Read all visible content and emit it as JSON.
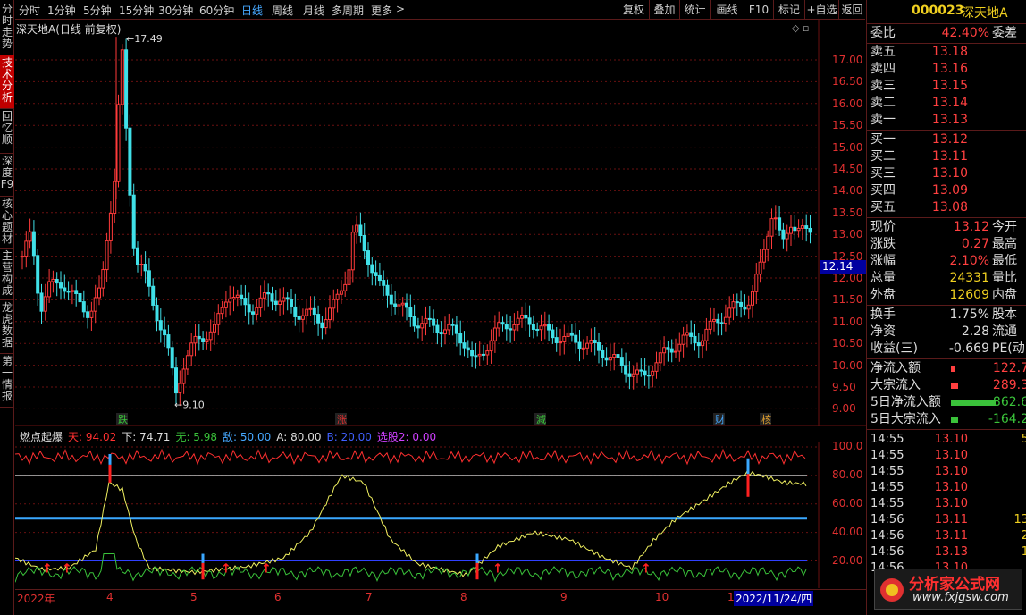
{
  "sidebar": {
    "tabs": [
      "分时走势",
      "技术分析",
      "回忆顺",
      "深度F9",
      "核心题材",
      "主营构成",
      "龙虎数据",
      "第一情报"
    ],
    "active": 1
  },
  "topbar": {
    "timeframes": [
      "分时",
      "1分钟",
      "5分钟",
      "15分钟",
      "30分钟",
      "60分钟",
      "日线",
      "周线",
      "月线",
      "多周期",
      "更多"
    ],
    "active_timeframe": "日线",
    "tools": [
      "复权",
      "叠加",
      "统计",
      "画线",
      "F10",
      "标记",
      "+自选",
      "返回"
    ]
  },
  "chart": {
    "title": "深天地A(日线 前复权)",
    "high_label": "17.49",
    "low_label": "9.10",
    "price_axis": [
      "17.00",
      "16.50",
      "16.00",
      "15.50",
      "15.00",
      "14.50",
      "14.00",
      "13.50",
      "13.00",
      "12.50",
      "12.00",
      "11.50",
      "11.00",
      "10.50",
      "10.00",
      "9.50",
      "9.00"
    ],
    "current_price": "12.14",
    "signals": [
      {
        "text": "跌",
        "color": "#3ac23a"
      },
      {
        "text": "涨",
        "color": "#e03030"
      },
      {
        "text": "減",
        "color": "#3ac23a"
      },
      {
        "text": "财",
        "color": "#46a8ff"
      },
      {
        "text": "核",
        "color": "#e0a030"
      }
    ]
  },
  "indicator": {
    "name": "燃点起爆",
    "params": [
      {
        "label": "天: 94.02",
        "color": "#ff3030"
      },
      {
        "label": "下: 74.71",
        "color": "#dddddd"
      },
      {
        "label": "无: 5.98",
        "color": "#3ac23a"
      },
      {
        "label": "敌: 50.00",
        "color": "#46a8ff"
      },
      {
        "label": "A: 80.00",
        "color": "#dddddd"
      },
      {
        "label": "B: 20.00",
        "color": "#4060ff"
      },
      {
        "label": "选股2: 0.00",
        "color": "#d040ff"
      }
    ],
    "axis": [
      "100.0",
      "80.00",
      "60.00",
      "40.00",
      "20.00"
    ]
  },
  "dates": [
    "2022年",
    "4",
    "5",
    "6",
    "7",
    "8",
    "9",
    "10",
    "1",
    "2022/11/24/四"
  ],
  "quote": {
    "code": "000023",
    "name": "深天地A",
    "weibi_label": "委比",
    "weibi": "42.40%",
    "weicha_label": "委差",
    "asks": [
      {
        "l": "卖五",
        "p": "13.18"
      },
      {
        "l": "卖四",
        "p": "13.16"
      },
      {
        "l": "卖三",
        "p": "13.15"
      },
      {
        "l": "卖二",
        "p": "13.14"
      },
      {
        "l": "卖一",
        "p": "13.13"
      }
    ],
    "bids": [
      {
        "l": "买一",
        "p": "13.12"
      },
      {
        "l": "买二",
        "p": "13.11"
      },
      {
        "l": "买三",
        "p": "13.10"
      },
      {
        "l": "买四",
        "p": "13.09"
      },
      {
        "l": "买五",
        "p": "13.08"
      }
    ],
    "stats": [
      {
        "l": "现价",
        "v": "13.12",
        "r": "今开"
      },
      {
        "l": "涨跌",
        "v": "0.27",
        "r": "最高"
      },
      {
        "l": "涨幅",
        "v": "2.10%",
        "r": "最低"
      },
      {
        "l": "总量",
        "v": "24331",
        "r": "量比"
      },
      {
        "l": "外盘",
        "v": "12609",
        "r": "内盘"
      }
    ],
    "stats2": [
      {
        "l": "换手",
        "v": "1.75%",
        "r": "股本"
      },
      {
        "l": "净资",
        "v": "2.28",
        "r": "流通"
      },
      {
        "l": "收益(三)",
        "v": "-0.669",
        "r": "PE(动)"
      }
    ],
    "flows": [
      {
        "l": "净流入额",
        "v": "122.7",
        "c": "#ff4040"
      },
      {
        "l": "大宗流入",
        "v": "289.3",
        "c": "#ff4040"
      },
      {
        "l": "5日净流入额",
        "v": "-862.6",
        "c": "#3ac23a"
      },
      {
        "l": "5日大宗流入",
        "v": "-164.2",
        "c": "#3ac23a"
      }
    ],
    "ticks": [
      {
        "t": "14:55",
        "p": "13.10",
        "v": "5"
      },
      {
        "t": "14:55",
        "p": "13.10",
        "v": ""
      },
      {
        "t": "14:55",
        "p": "13.10",
        "v": ""
      },
      {
        "t": "14:55",
        "p": "13.10",
        "v": ""
      },
      {
        "t": "14:55",
        "p": "13.10",
        "v": ""
      },
      {
        "t": "14:56",
        "p": "13.11",
        "v": "13"
      },
      {
        "t": "14:56",
        "p": "13.11",
        "v": "2"
      },
      {
        "t": "14:56",
        "p": "13.13",
        "v": "1"
      },
      {
        "t": "14:56",
        "p": "13.10",
        "v": ""
      }
    ]
  },
  "watermark": {
    "name": "分析家公式网",
    "url": "www.fxjgsw.com"
  }
}
